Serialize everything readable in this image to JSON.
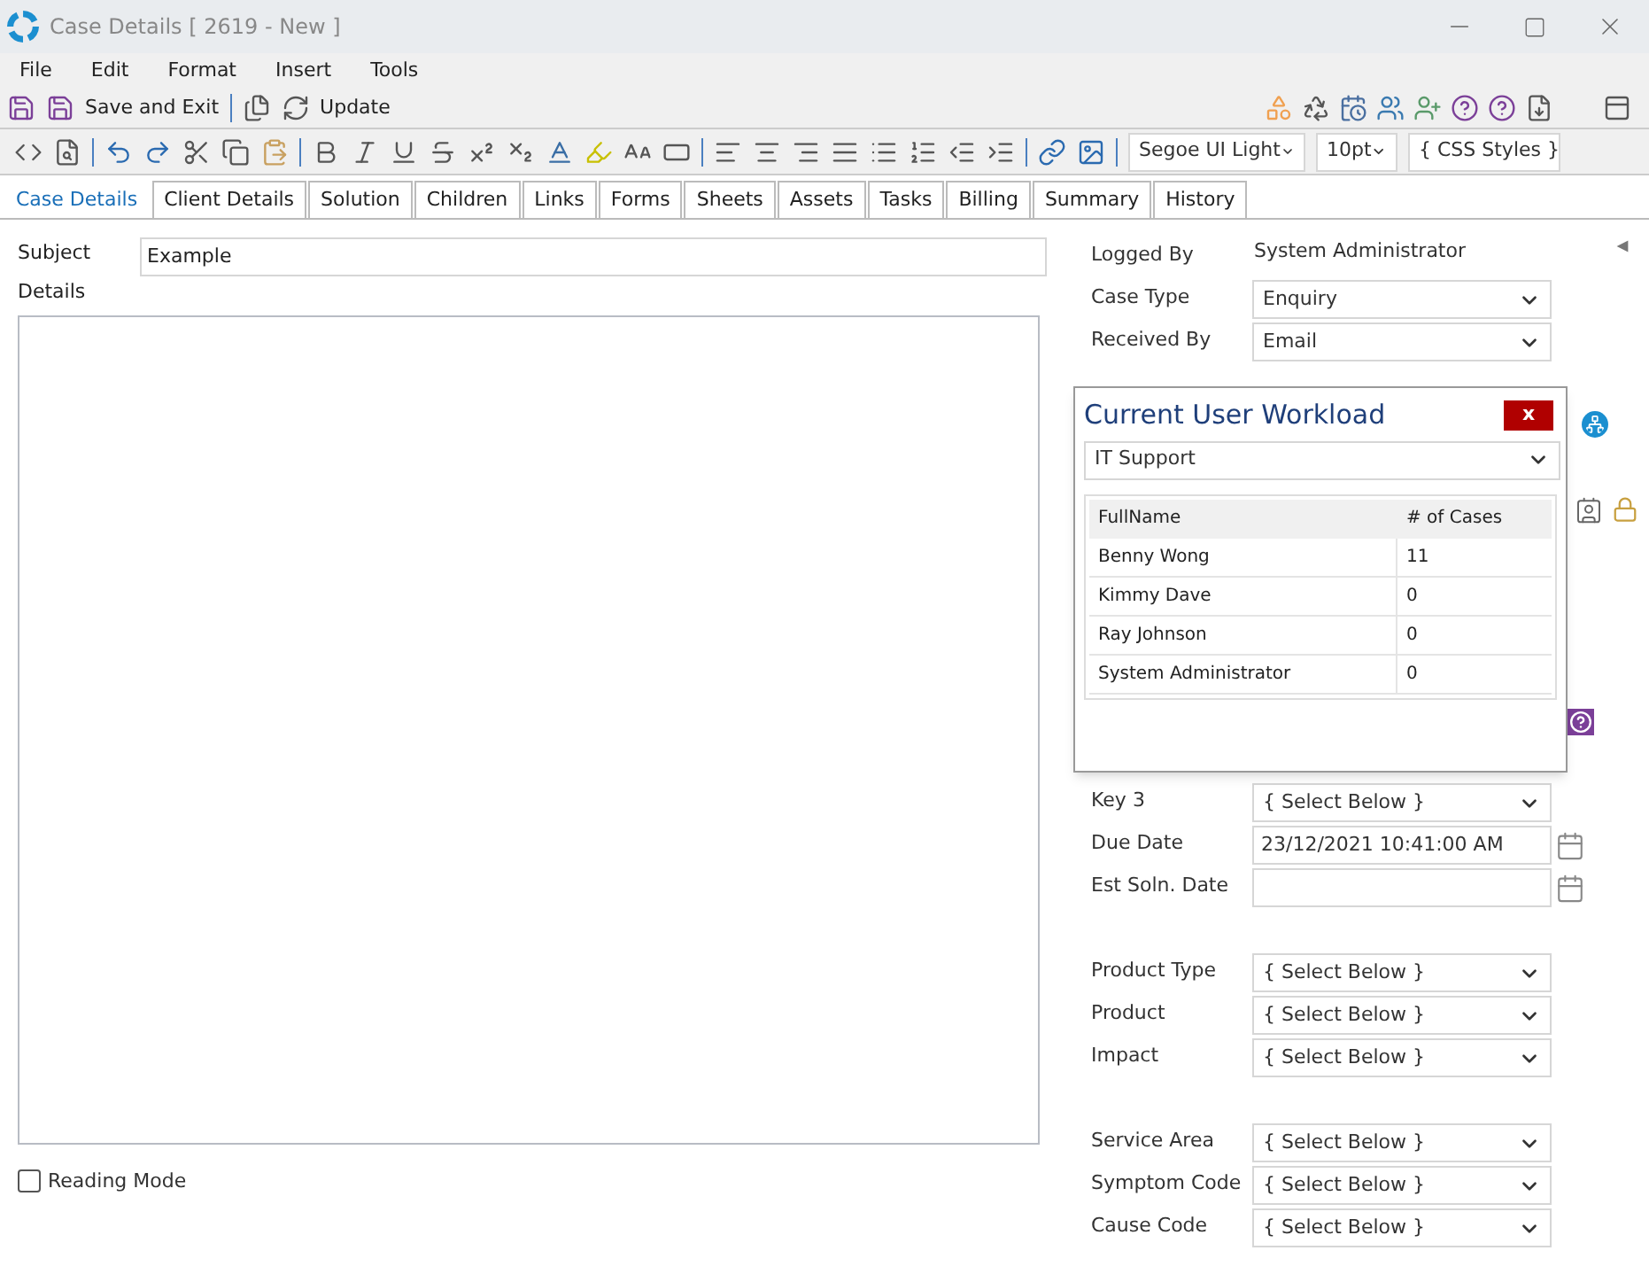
{
  "window": {
    "title": "Case Details [ 2619 - New ]"
  },
  "menu": [
    "File",
    "Edit",
    "Format",
    "Insert",
    "Tools"
  ],
  "toolbar": {
    "save_and_exit": "Save and Exit",
    "update": "Update"
  },
  "format_toolbar": {
    "font": "Segoe UI Light",
    "size": "10pt",
    "styles": "{ CSS Styles }"
  },
  "tabs": [
    {
      "label": "Case Details",
      "selected": true
    },
    {
      "label": "Client Details",
      "selected": false
    },
    {
      "label": "Solution",
      "selected": false
    },
    {
      "label": "Children",
      "selected": false
    },
    {
      "label": "Links",
      "selected": false
    },
    {
      "label": "Forms",
      "selected": false
    },
    {
      "label": "Sheets",
      "selected": false
    },
    {
      "label": "Assets",
      "selected": false
    },
    {
      "label": "Tasks",
      "selected": false
    },
    {
      "label": "Billing",
      "selected": false
    },
    {
      "label": "Summary",
      "selected": false
    },
    {
      "label": "History",
      "selected": false
    }
  ],
  "subject": {
    "label": "Subject",
    "value": "Example"
  },
  "details": {
    "label": "Details"
  },
  "reading_mode": {
    "label": "Reading Mode",
    "checked": false
  },
  "fields_top": [
    {
      "kind": "text",
      "label": "Logged By",
      "value": "System Administrator"
    },
    {
      "kind": "select",
      "label": "Case Type",
      "value": "Enquiry"
    },
    {
      "kind": "select",
      "label": "Received By",
      "value": "Email"
    }
  ],
  "fields_middle": [
    {
      "kind": "select",
      "label": "Key 3",
      "value": "{ Select Below }"
    },
    {
      "kind": "date",
      "label": "Due Date",
      "value": "23/12/2021 10:41:00 AM"
    },
    {
      "kind": "date",
      "label": "Est Soln. Date"
    }
  ],
  "fields_product": [
    {
      "kind": "select",
      "label": "Product Type",
      "value": "{ Select Below }"
    },
    {
      "kind": "select",
      "label": "Product",
      "value": "{ Select Below }"
    },
    {
      "kind": "select",
      "label": "Impact",
      "value": "{ Select Below }"
    }
  ],
  "fields_service": [
    {
      "kind": "select",
      "label": "Service Area",
      "value": "{ Select Below }"
    },
    {
      "kind": "select",
      "label": "Symptom Code",
      "value": "{ Select Below }"
    },
    {
      "kind": "select",
      "label": "Cause Code",
      "value": "{ Select Below }"
    }
  ],
  "workload_popup": {
    "title": "Current User Workload",
    "close": "x",
    "group": "IT Support",
    "columns": [
      "FullName",
      "# of Cases"
    ],
    "rows": [
      [
        "Benny Wong",
        "11"
      ],
      [
        "Kimmy Dave",
        "0"
      ],
      [
        "Ray Johnson",
        "0"
      ],
      [
        "System Administrator",
        "0"
      ]
    ]
  }
}
